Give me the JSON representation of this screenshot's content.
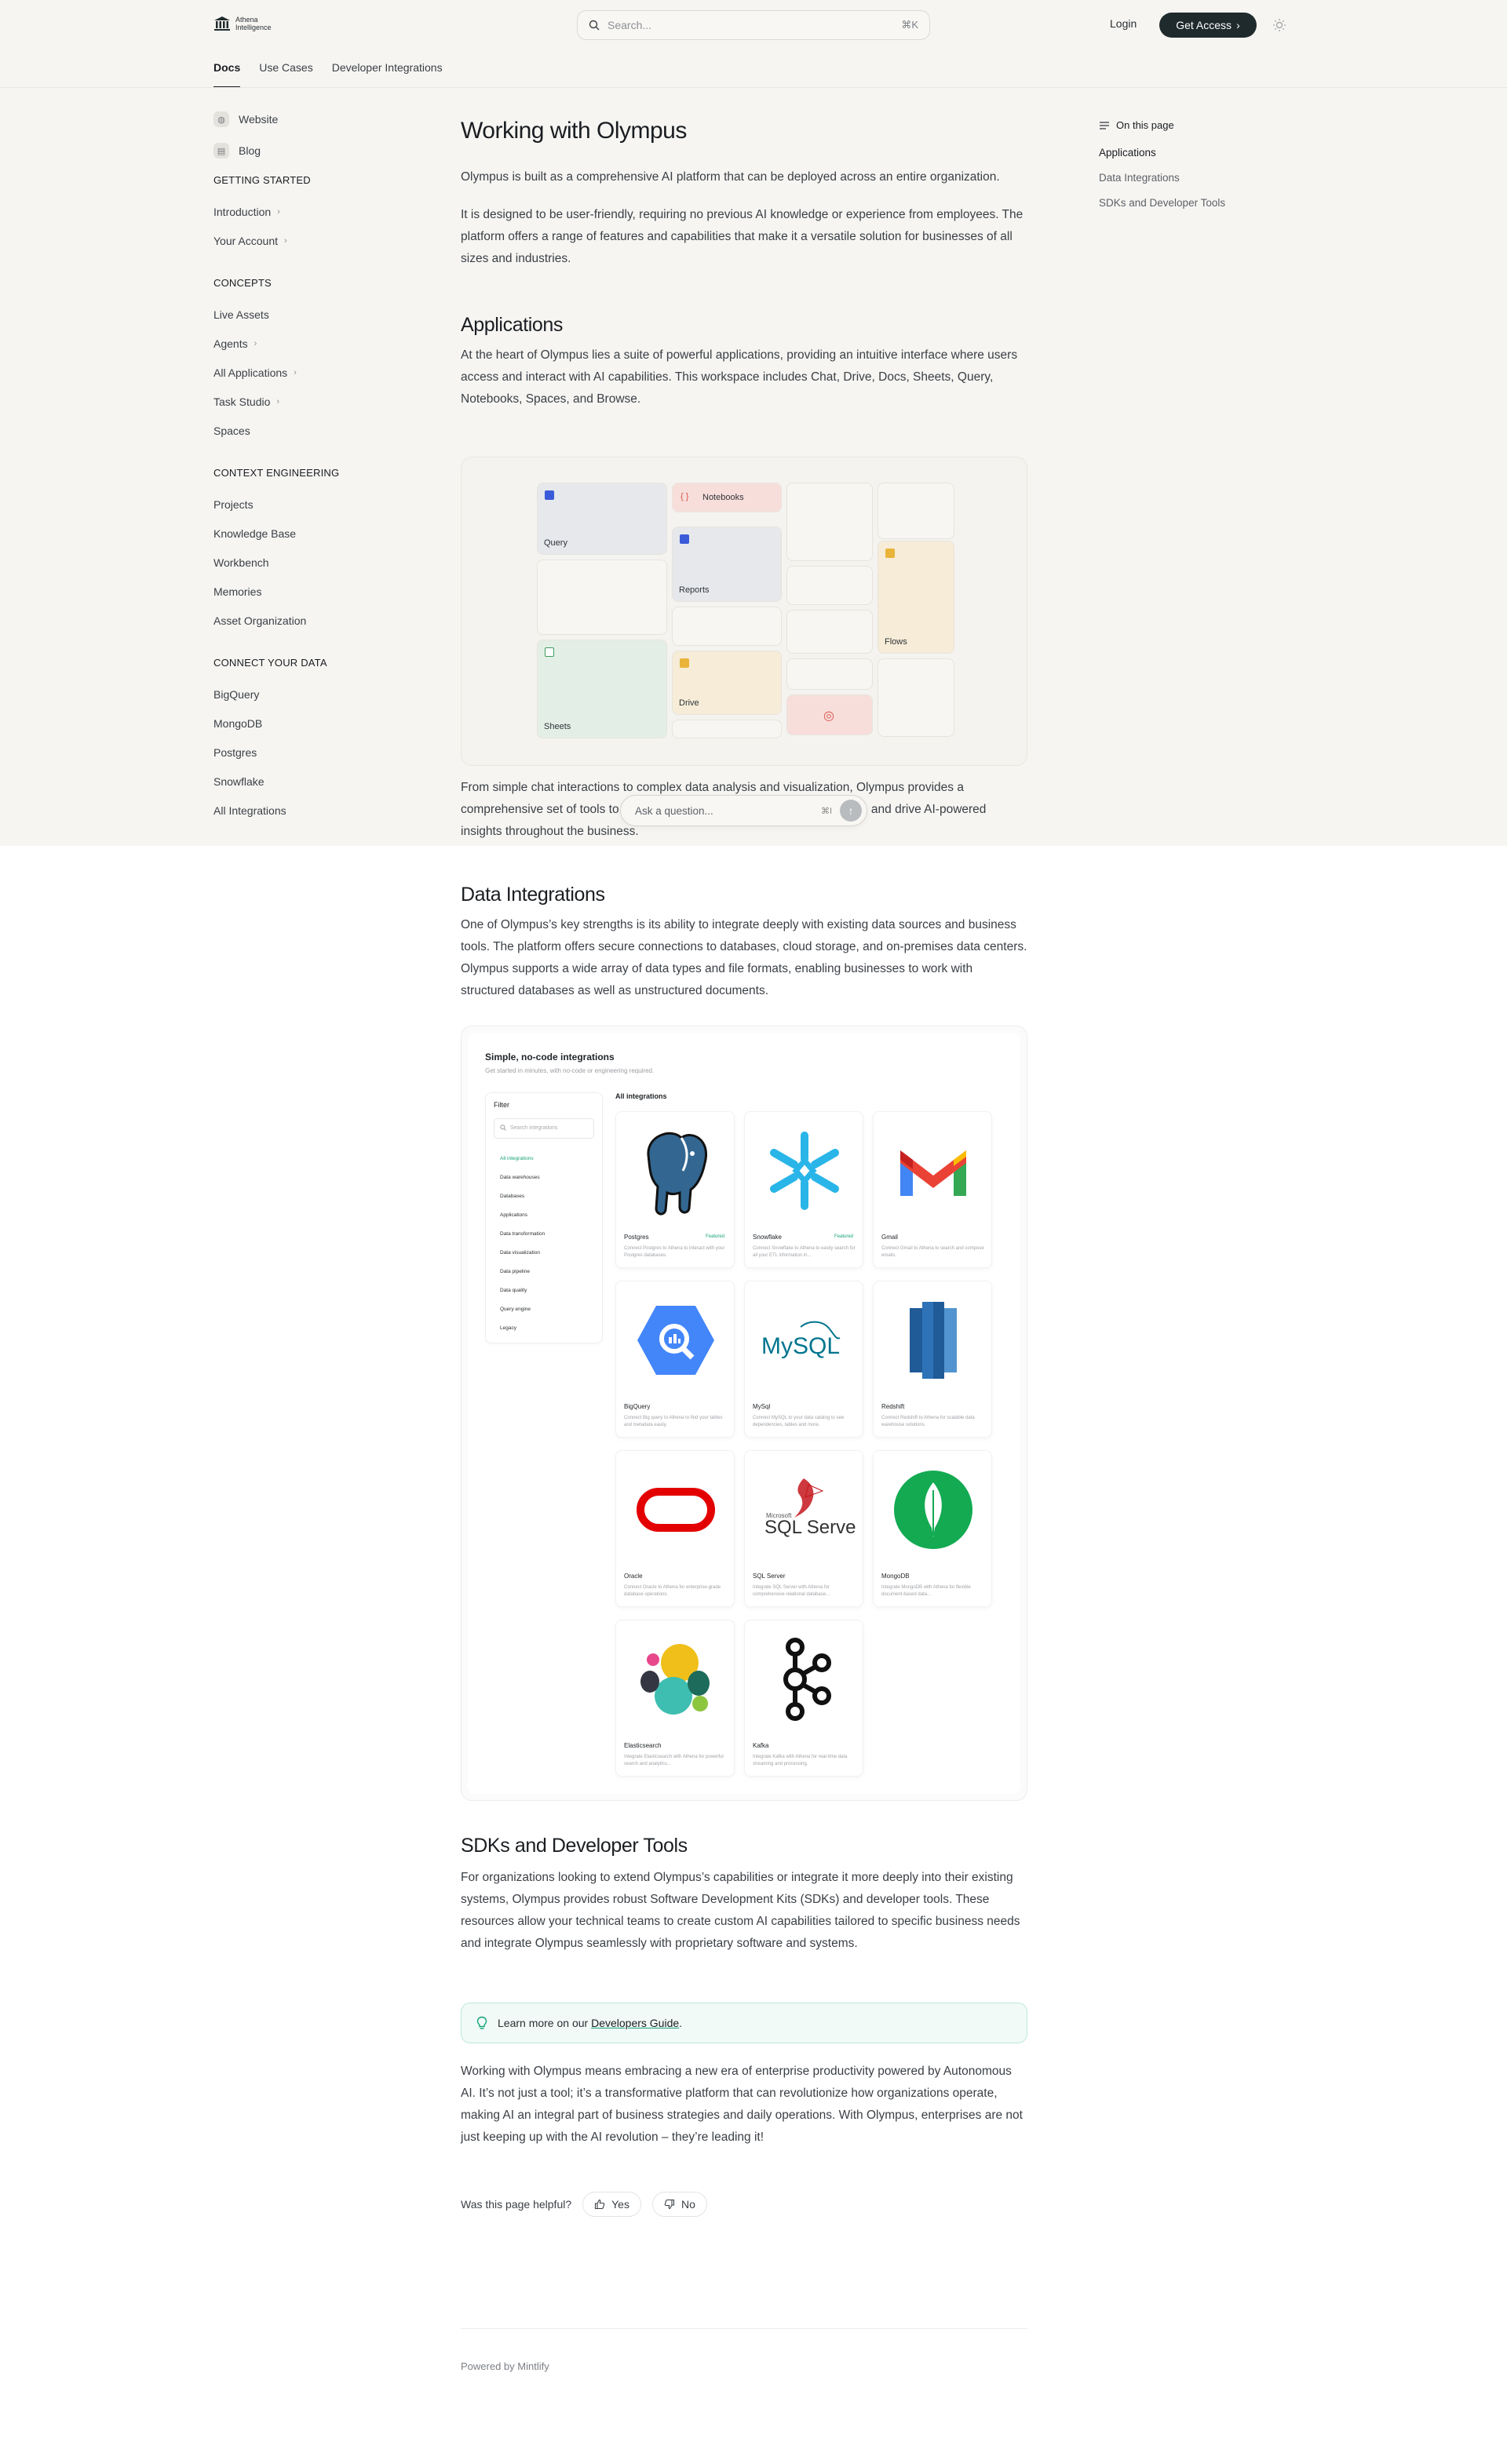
{
  "brand": {
    "line1": "Athena",
    "line2": "Intelligence"
  },
  "search": {
    "placeholder": "Search...",
    "shortcut": "⌘K"
  },
  "header": {
    "login": "Login",
    "cta": "Get Access"
  },
  "tabs": [
    "Docs",
    "Use Cases",
    "Developer Integrations"
  ],
  "sidebar": {
    "top_links": [
      "Website",
      "Blog"
    ],
    "sections": [
      {
        "title": "GETTING STARTED",
        "items": [
          {
            "label": "Introduction",
            "chevron": true
          },
          {
            "label": "Your Account",
            "chevron": true
          }
        ]
      },
      {
        "title": "CONCEPTS",
        "items": [
          {
            "label": "Live Assets",
            "chevron": false
          },
          {
            "label": "Agents",
            "chevron": true
          },
          {
            "label": "All Applications",
            "chevron": true
          },
          {
            "label": "Task Studio",
            "chevron": true
          },
          {
            "label": "Spaces",
            "chevron": false
          }
        ]
      },
      {
        "title": "CONTEXT ENGINEERING",
        "items": [
          {
            "label": "Projects",
            "chevron": false
          },
          {
            "label": "Knowledge Base",
            "chevron": false
          },
          {
            "label": "Workbench",
            "chevron": false
          },
          {
            "label": "Memories",
            "chevron": false
          },
          {
            "label": "Asset Organization",
            "chevron": false
          }
        ]
      },
      {
        "title": "CONNECT YOUR DATA",
        "items": [
          {
            "label": "BigQuery",
            "chevron": false
          },
          {
            "label": "MongoDB",
            "chevron": false
          },
          {
            "label": "Postgres",
            "chevron": false
          },
          {
            "label": "Snowflake",
            "chevron": false
          },
          {
            "label": "All Integrations",
            "chevron": false
          }
        ]
      }
    ]
  },
  "page": {
    "title": "Working with Olympus",
    "intro1": "Olympus is built as a comprehensive AI platform that can be deployed across an entire organization.",
    "intro2": "It is designed to be user-friendly, requiring no previous AI knowledge or experience from employees. The platform offers a range of features and capabilities that make it a versatile solution for businesses of all sizes and industries.",
    "applications_heading": "Applications",
    "applications_p": "At the heart of Olympus lies a suite of powerful applications, providing an intuitive interface where users access and interact with AI capabilities. This workspace includes Chat, Drive, Docs, Sheets, Query, Notebooks, Spaces, and Browse.",
    "applications_p2": "From simple chat interactions to complex data analysis and visualization, Olympus provides a comprehensive set of tools to help teams collaborate, streamline workflows, and drive AI-powered insights throughout the business.",
    "data_heading": "Data Integrations",
    "data_p": "One of Olympus’s key strengths is its ability to integrate deeply with existing data sources and business tools. The platform offers secure connections to databases, cloud storage, and on-premises data centers. Olympus supports a wide array of data types and file formats, enabling businesses to work with structured databases as well as unstructured documents.",
    "sdk_heading": "SDKs and Developer Tools",
    "sdk_p": "For organizations looking to extend Olympus’s capabilities or integrate it more deeply into their existing systems, Olympus provides robust Software Development Kits (SDKs) and developer tools. These resources allow your technical teams to create custom AI capabilities tailored to specific business needs and integrate Olympus seamlessly with proprietary software and systems.",
    "tip_prefix": "Learn more on our ",
    "tip_link": "Developers Guide",
    "tip_suffix": ".",
    "closing_p": "Working with Olympus means embracing a new era of enterprise productivity powered by Autonomous AI. It’s not just a tool; it’s a transformative platform that can revolutionize how organizations operate, making AI an integral part of business strategies and daily operations. With Olympus, enterprises are not just keeping up with the AI revolution – they’re leading it!",
    "helpful_label": "Was this page helpful?",
    "yes": "Yes",
    "no": "No",
    "powered": "Powered by Mintlify"
  },
  "app_tiles": {
    "query": "Query",
    "notebooks": "Notebooks",
    "reports": "Reports",
    "flows": "Flows",
    "sheets": "Sheets",
    "drive": "Drive"
  },
  "ask": {
    "placeholder": "Ask a question...",
    "shortcut": "⌘I"
  },
  "integrations": {
    "title": "Simple, no-code integrations",
    "subtitle": "Get started in minutes, with no-code or engineering required.",
    "filter_title": "Filter",
    "filter_search": "Search integrations",
    "filters": [
      "All integrations",
      "Data warehouses",
      "Databases",
      "Applications",
      "Data transformation",
      "Data visualization",
      "Data pipeline",
      "Data quality",
      "Query engine",
      "Legacy"
    ],
    "all_label": "All integrations",
    "featured": "Featured",
    "cards": [
      {
        "name": "Postgres",
        "desc": "Connect Postgres to Athena to interact with your Postgres databases.",
        "featured": true
      },
      {
        "name": "Snowflake",
        "desc": "Connect Snowflake to Athena to easily search for all your ETL information in...",
        "featured": true
      },
      {
        "name": "Gmail",
        "desc": "Connect Gmail to Athena to search and compose emails.",
        "featured": false
      },
      {
        "name": "BigQuery",
        "desc": "Connect Big query to Athena to find your tables and metadata easily.",
        "featured": false
      },
      {
        "name": "MySql",
        "desc": "Connect MySQL to your data catalog to see dependencies, tables and more.",
        "featured": false
      },
      {
        "name": "Redshift",
        "desc": "Connect Redshift to Athena for scalable data warehouse solutions.",
        "featured": false
      },
      {
        "name": "Oracle",
        "desc": "Connect Oracle to Athena for enterprise-grade database operations.",
        "featured": false
      },
      {
        "name": "SQL Server",
        "desc": "Integrate SQL Server with Athena for comprehensive relational database...",
        "featured": false
      },
      {
        "name": "MongoDB",
        "desc": "Integrate MongoDB with Athena for flexible document-based data...",
        "featured": false
      },
      {
        "name": "Elasticsearch",
        "desc": "Integrate Elasticsearch with Athena for powerful search and analytics...",
        "featured": false
      },
      {
        "name": "Kafka",
        "desc": "Integrate Kafka with Athena for real-time data streaming and processing.",
        "featured": false
      }
    ],
    "logo_texts": {
      "mysql": "MySQL",
      "sqlserver": "SQL Server",
      "microsoft": "Microsoft"
    }
  },
  "toc": {
    "title": "On this page",
    "items": [
      "Applications",
      "Data Integrations",
      "SDKs and Developer Tools"
    ]
  },
  "colors": {
    "accent": "#16a37a",
    "cta_bg": "#1f2a2c",
    "beige": "#f6f5f2"
  }
}
